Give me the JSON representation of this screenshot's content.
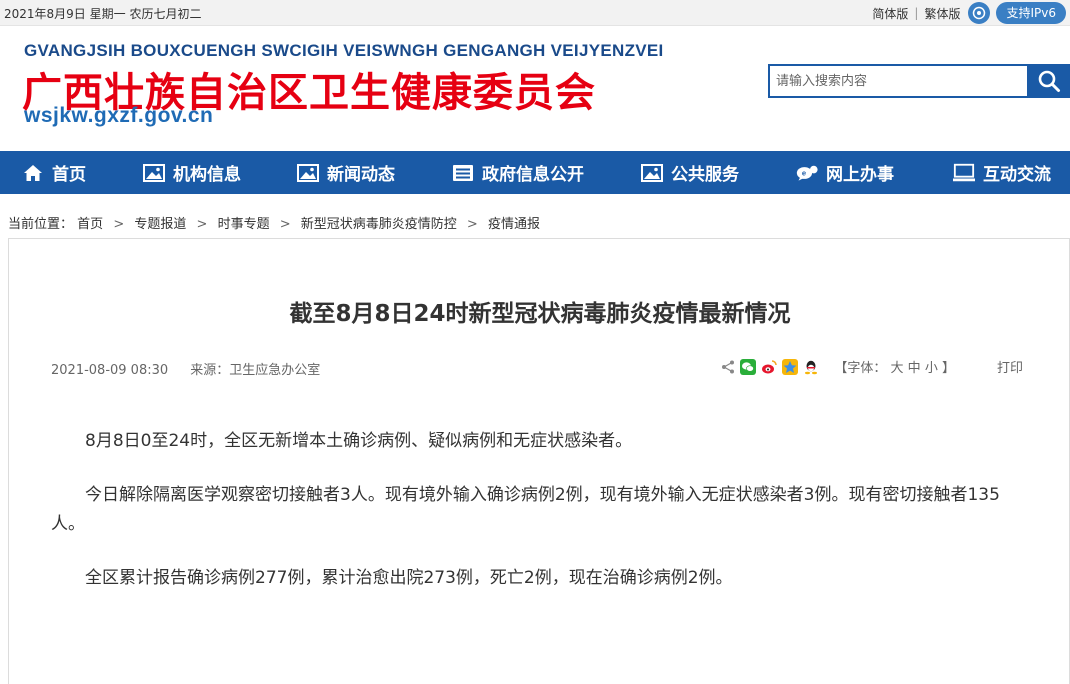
{
  "topbar": {
    "date": "2021年8月9日  星期一  农历七月初二",
    "simplified": "简体版",
    "separator": "|",
    "traditional": "繁体版",
    "ipv6": "支持IPv6"
  },
  "header": {
    "en_name": "GVANGJSIH BOUXCUENGH SWCIGIH VEISWNGH GENGANGH VEIJYENZVEI",
    "zh_name": "广西壮族自治区卫生健康委员会",
    "url": "wsjkw.gxzf.gov.cn",
    "search_placeholder": "请输入搜索内容"
  },
  "nav": {
    "items": [
      {
        "label": "首页",
        "icon": "home-icon"
      },
      {
        "label": "机构信息",
        "icon": "image-icon"
      },
      {
        "label": "新闻动态",
        "icon": "image-icon"
      },
      {
        "label": "政府信息公开",
        "icon": "document-icon"
      },
      {
        "label": "公共服务",
        "icon": "image-icon"
      },
      {
        "label": "网上办事",
        "icon": "chat-icon"
      },
      {
        "label": "互动交流",
        "icon": "monitor-icon"
      }
    ]
  },
  "breadcrumb": {
    "prefix": "当前位置：",
    "items": [
      "首页",
      "专题报道",
      "时事专题",
      "新型冠状病毒肺炎疫情防控",
      "疫情通报"
    ],
    "separator": ">"
  },
  "article": {
    "title": "截至8月8日24时新型冠状病毒肺炎疫情最新情况",
    "datetime": "2021-08-09 08:30",
    "source": "来源：卫生应急办公室",
    "font_label_open": "【字体：",
    "font_large": "大",
    "font_medium": "中",
    "font_small": "小",
    "font_label_close": "】",
    "print": "打印",
    "paragraphs": [
      "8月8日0至24时，全区无新增本土确诊病例、疑似病例和无症状感染者。",
      "今日解除隔离医学观察密切接触者3人。现有境外输入确诊病例2例，现有境外输入无症状感染者3例。现有密切接触者135人。",
      "全区累计报告确诊病例277例，累计治愈出院273例，死亡2例，现在治确诊病例2例。"
    ]
  },
  "colors": {
    "nav_bg": "#1a5aa6",
    "brand_red": "#e60012",
    "brand_blue": "#1f6bb5"
  }
}
